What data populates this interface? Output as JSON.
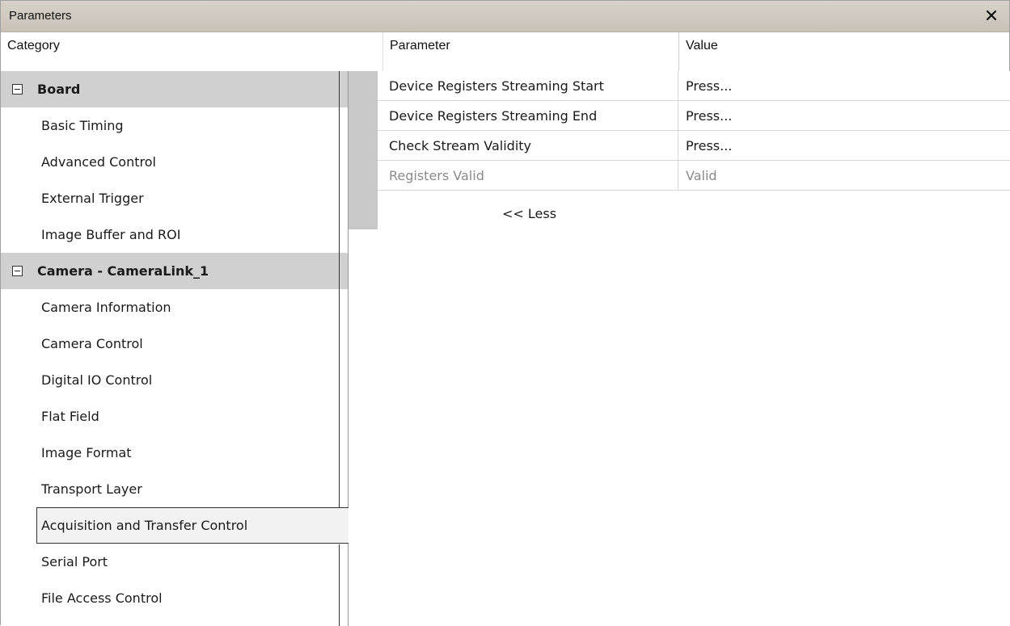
{
  "window": {
    "title": "Parameters",
    "close_icon": "close-icon"
  },
  "headers": {
    "category": "Category",
    "parameter": "Parameter",
    "value": "Value"
  },
  "categories": {
    "board": {
      "label": "Board",
      "items": [
        "Basic Timing",
        "Advanced Control",
        "External Trigger",
        "Image Buffer and ROI"
      ]
    },
    "camera": {
      "label": "Camera - CameraLink_1",
      "items": [
        "Camera Information",
        "Camera Control",
        "Digital IO Control",
        "Flat Field",
        "Image Format",
        "Transport Layer",
        "Acquisition and Transfer Control",
        "Serial Port",
        "File Access Control"
      ]
    },
    "selected": "Acquisition and Transfer Control"
  },
  "parameters": [
    {
      "name": "Device Registers Streaming Start",
      "value": "Press..."
    },
    {
      "name": "Device Registers Streaming End",
      "value": "Press..."
    },
    {
      "name": "Check Stream Validity",
      "value": "Press..."
    },
    {
      "name": "Registers Valid",
      "value": "Valid"
    }
  ],
  "less_link": "<< Less",
  "colors": {
    "titlebar": "#cdc7bd",
    "group_bg": "#d0d0d0",
    "gutter": "#c8c8c8",
    "disabled_text": "#8a8a8a"
  }
}
